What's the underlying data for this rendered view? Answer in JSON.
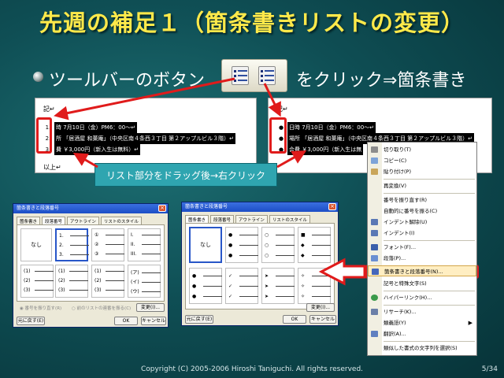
{
  "slide": {
    "title": "先週の補足１（箇条書きリストの変更）",
    "bullet_text_a": "ツールバーのボタン",
    "bullet_text_b": "をクリック⇒箇条書き",
    "callout": "リスト部分をドラッグ後→右クリック",
    "footer": "Copyright (C) 2005-2006 Hiroshi Taniguchi. All rights reserved.",
    "page": "5/34"
  },
  "doc_left": {
    "ki": "記↵",
    "markers": [
      "1.",
      "2.",
      "3."
    ],
    "rows": [
      "時  7月10日（金）PM6：00～↵",
      "所 「居酒屋 和菓庵」（中央区南４条西３丁目 第２アップルビル３階）↵",
      "費 ￥3,000円（新入生は無料）↵"
    ],
    "ijo": "以上↵"
  },
  "doc_right": {
    "ki": "記↵",
    "markers": [
      "●",
      "●",
      "●"
    ],
    "rows": [
      "日時 7月10日（金）PM6：00～↵",
      "場所 「居酒屋 和菓庵」（中央区南４条西３丁目 第２アップルビル３階）↵",
      "会費 ￥3,000円（新入生は無"
    ]
  },
  "dialog_left": {
    "title": "箇条書きと段落番号",
    "tabs": [
      "箇条書き",
      "段落番号",
      "アウトライン",
      "リストのスタイル"
    ],
    "none_label": "なし",
    "numbers_top": [
      [
        "1.",
        "2.",
        "3."
      ],
      [
        "①",
        "②",
        "③"
      ],
      [
        "I.",
        "II.",
        "III."
      ]
    ],
    "numbers_bottom": [
      [
        "(1)",
        "(2)",
        "(3)"
      ],
      [
        "(1)",
        "(2)",
        "(3)"
      ],
      [
        "(1)",
        "(2)",
        "(3)"
      ],
      [
        "(ア)",
        "(イ)",
        "(ウ)"
      ]
    ],
    "opt1": "◉ 番号を振り直す(R)",
    "opt2": "○ 前のリストの連番を振る(C)",
    "reset": "元に戻す(E)",
    "change": "変更(I)...",
    "ok": "OK",
    "cancel": "キャンセル"
  },
  "dialog_right": {
    "title": "箇条書きと段落番号",
    "tabs": [
      "箇条書き",
      "段落番号",
      "アウトライン",
      "リストのスタイル"
    ],
    "none_label": "なし",
    "bullets_top": [
      "●",
      "○",
      "■",
      "◆"
    ],
    "bullets_bottom": [
      "●",
      "✓",
      "➤",
      "✧"
    ],
    "reset": "元に戻す(E)",
    "change": "変更(I)...",
    "ok": "OK",
    "cancel": "キャンセル"
  },
  "context_menu": {
    "items": [
      {
        "label": "切り取り(T)",
        "icon": "scissors-icon"
      },
      {
        "label": "コピー(C)",
        "icon": "copy-icon"
      },
      {
        "label": "貼り付け(P)",
        "icon": "paste-icon"
      },
      {
        "label": "再変換(V)",
        "icon": ""
      },
      {
        "label": "番号を振り直す(R)",
        "icon": ""
      },
      {
        "label": "自動的に番号を振る(C)",
        "icon": ""
      },
      {
        "label": "インデント解除(U)",
        "icon": "outdent-icon"
      },
      {
        "label": "インデント(I)",
        "icon": "indent-icon"
      },
      {
        "label": "フォント(F)...",
        "icon": "font-icon"
      },
      {
        "label": "段落(P)...",
        "icon": "paragraph-icon"
      },
      {
        "label": "箇条書きと段落番号(N)...",
        "icon": "bullets-icon"
      },
      {
        "label": "記号と特殊文字(S)",
        "icon": ""
      },
      {
        "label": "ハイパーリンク(H)...",
        "icon": "hyperlink-icon"
      },
      {
        "label": "リサーチ(K)...",
        "icon": "research-icon"
      },
      {
        "label": "類義語(Y)",
        "icon": ""
      },
      {
        "label": "翻訳(A)...",
        "icon": "translate-icon"
      },
      {
        "label": "類似した書式の文字列を選択(S)",
        "icon": ""
      }
    ],
    "highlight_color": "#ffeec2"
  },
  "colors": {
    "title": "#ffe94a",
    "arrow": "#e01b1b",
    "callout": "#2fa5b0"
  }
}
